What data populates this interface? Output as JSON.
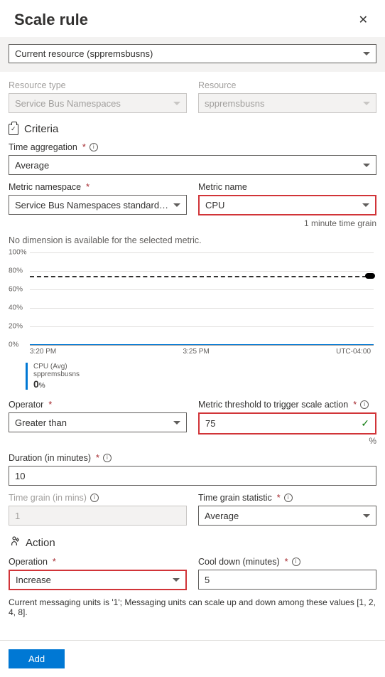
{
  "header": {
    "title": "Scale rule"
  },
  "topSelect": {
    "label": "Current resource (sppremsbusns)"
  },
  "resourceType": {
    "label": "Resource type",
    "value": "Service Bus Namespaces"
  },
  "resource": {
    "label": "Resource",
    "value": "sppremsbusns"
  },
  "sections": {
    "criteria": "Criteria",
    "action": "Action"
  },
  "timeAggregation": {
    "label": "Time aggregation",
    "value": "Average"
  },
  "metricNamespace": {
    "label": "Metric namespace",
    "value": "Service Bus Namespaces standard me..."
  },
  "metricName": {
    "label": "Metric name",
    "value": "CPU",
    "hint": "1 minute time grain"
  },
  "noDimension": "No dimension is available for the selected metric.",
  "chart_data": {
    "type": "line",
    "ylabel": "",
    "ylim": [
      0,
      100
    ],
    "yticks": [
      "0%",
      "20%",
      "40%",
      "60%",
      "80%",
      "100%"
    ],
    "xticks": [
      "3:20 PM",
      "3:25 PM",
      "UTC-04:00"
    ],
    "threshold_pct": 75,
    "series": [
      {
        "name": "CPU (Avg)",
        "resource": "sppremsbusns",
        "current_value": 0,
        "unit": "%",
        "approx_constant_value": 0
      }
    ]
  },
  "operator": {
    "label": "Operator",
    "value": "Greater than"
  },
  "threshold": {
    "label": "Metric threshold to trigger scale action",
    "value": "75",
    "unit": "%"
  },
  "duration": {
    "label": "Duration (in minutes)",
    "value": "10"
  },
  "timeGrain": {
    "label": "Time grain (in mins)",
    "value": "1"
  },
  "timeGrainStat": {
    "label": "Time grain statistic",
    "value": "Average"
  },
  "operation": {
    "label": "Operation",
    "value": "Increase"
  },
  "coolDown": {
    "label": "Cool down (minutes)",
    "value": "5"
  },
  "note": "Current messaging units is '1'; Messaging units can scale up and down among these values [1, 2, 4, 8].",
  "footer": {
    "add": "Add"
  }
}
